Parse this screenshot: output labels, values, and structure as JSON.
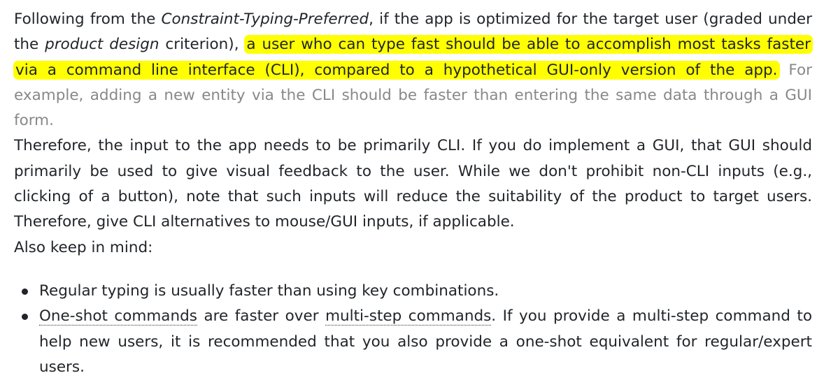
{
  "para1": {
    "t1": "Following from the ",
    "t2": "Constraint-Typing-Preferred",
    "t3": ", if the app is optimized for the target user (graded under the ",
    "t4": "product design",
    "t5": " criterion), ",
    "highlight": "a user who can type fast should be able to accomplish most tasks faster via a command line interface (CLI), compared to a hypothetical GUI-only version of the app.",
    "note": " For example, adding a new entity via the CLI should be faster than entering the same data through a GUI form."
  },
  "para2": "Therefore, the input to the app needs to be primarily CLI. If you do implement a GUI, that GUI should primarily be used to give visual feedback to the user. While we don't prohibit non-CLI inputs (e.g., clicking of a button), note that such inputs will reduce the suitability of the product to target users. Therefore, give CLI alternatives to mouse/GUI inputs, if applicable.",
  "para3": "Also keep in mind:",
  "bullets": {
    "b1": "Regular typing is usually faster than using key combinations.",
    "b2": {
      "term1": "One-shot commands",
      "t2": " are faster over ",
      "term2": "multi-step commands",
      "t3": ". If you provide a multi-step command to help new users, it is recommended that you also provide a one-shot equivalent for regular/expert users."
    }
  }
}
